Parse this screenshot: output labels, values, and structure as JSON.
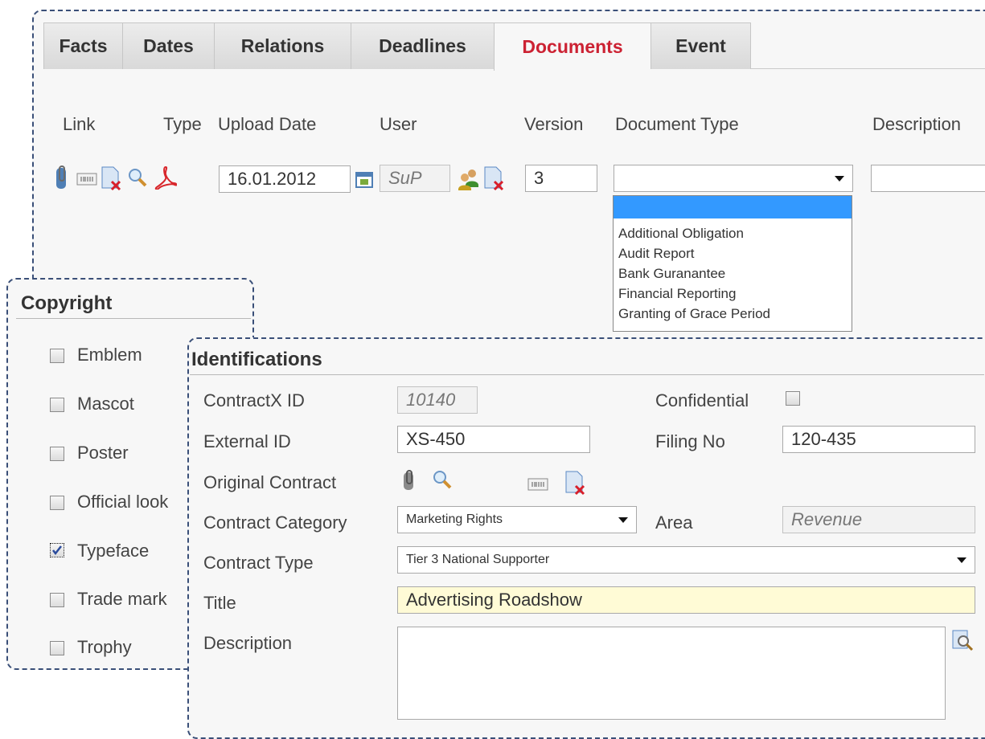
{
  "tabs": [
    {
      "label": "Facts"
    },
    {
      "label": "Dates"
    },
    {
      "label": "Relations"
    },
    {
      "label": "Deadlines"
    },
    {
      "label": "Documents",
      "active": true
    },
    {
      "label": "Event"
    }
  ],
  "documents": {
    "columns": {
      "link": "Link",
      "type": "Type",
      "upload_date": "Upload Date",
      "user": "User",
      "version": "Version",
      "document_type": "Document Type",
      "description": "Description"
    },
    "row": {
      "upload_date": "16.01.2012",
      "user": "SuP",
      "version": "3",
      "document_type": "",
      "description": ""
    },
    "document_type_options": [
      "",
      "Additional Obligation",
      "Audit Report",
      "Bank Guranantee",
      "Financial Reporting",
      "Granting of Grace Period"
    ]
  },
  "copyright": {
    "title": "Copyright",
    "items": [
      {
        "label": "Emblem",
        "checked": false
      },
      {
        "label": "Mascot",
        "checked": false
      },
      {
        "label": "Poster",
        "checked": false
      },
      {
        "label": "Official look",
        "checked": false
      },
      {
        "label": "Typeface",
        "checked": true
      },
      {
        "label": "Trade mark",
        "checked": false
      },
      {
        "label": "Trophy",
        "checked": false
      }
    ]
  },
  "identifications": {
    "title": "Identifications",
    "contractx_id_label": "ContractX ID",
    "contractx_id": "10140",
    "confidential_label": "Confidential",
    "confidential": false,
    "external_id_label": "External ID",
    "external_id": "XS-450",
    "filing_no_label": "Filing No",
    "filing_no": "120-435",
    "original_contract_label": "Original Contract",
    "contract_category_label": "Contract Category",
    "contract_category": "Marketing Rights",
    "area_label": "Area",
    "area": "Revenue",
    "contract_type_label": "Contract Type",
    "contract_type": "Tier 3 National Supporter",
    "title_label": "Title",
    "title_value": "Advertising Roadshow",
    "description_label": "Description",
    "description_value": ""
  },
  "colors": {
    "active_tab": "#cc2233",
    "panel_border": "#3a4f78",
    "highlight": "#3399ff",
    "title_field": "#fffbd6"
  }
}
